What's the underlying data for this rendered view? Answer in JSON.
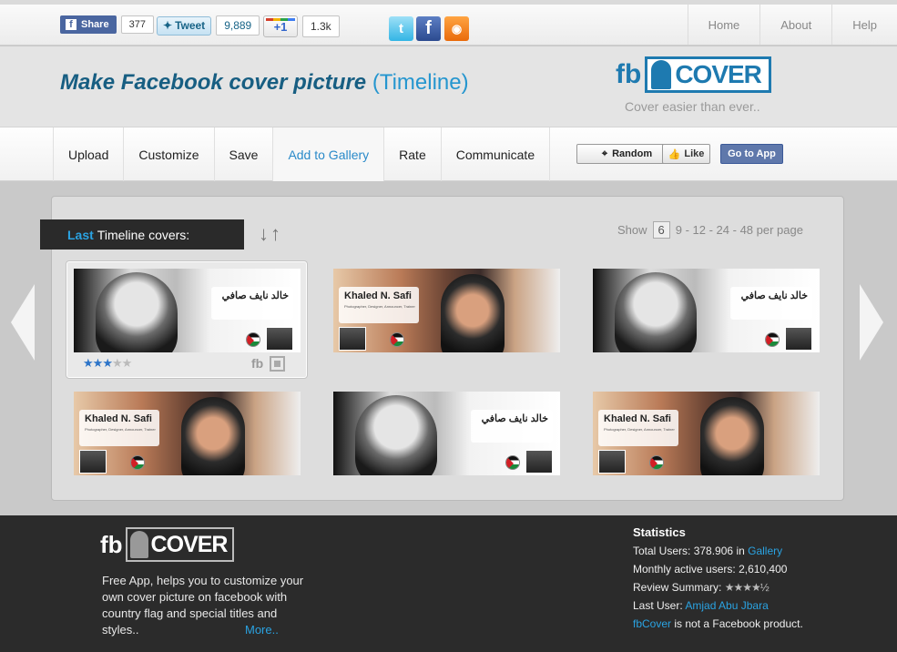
{
  "topbar": {
    "fb_share_label": "Share",
    "fb_share_count": "377",
    "tweet_label": "Tweet",
    "tweet_count": "9,889",
    "gplus_label": "+1",
    "gplus_count": "1.3k",
    "nav": [
      "Home",
      "About",
      "Help"
    ]
  },
  "header": {
    "title": "Make Facebook cover picture",
    "title_highlight": "(Timeline)",
    "logo_fb": "fb",
    "logo_text": "COVER",
    "tagline": "Cover easier than ever.."
  },
  "navbar": {
    "items": [
      "Upload",
      "Customize",
      "Save",
      "Add to Gallery",
      "Rate",
      "Communicate"
    ],
    "active": "Add to Gallery",
    "random_label": "Random",
    "like_label": "Like",
    "go_app_label": "Go to App"
  },
  "gallery": {
    "heading_bold": "Last",
    "heading_rest": "Timeline covers:",
    "show_label": "Show",
    "show_selected": "6",
    "show_options": "9 - 12 - 24 - 48 per page",
    "covers": [
      {
        "style": "bw",
        "name": "خالد نايف صافي"
      },
      {
        "style": "col",
        "name": "Khaled N. Safi",
        "sub": "Photographer, Designer, Announcer, Trainer"
      },
      {
        "style": "bw",
        "name": "خالد نايف صافي"
      },
      {
        "style": "col",
        "name": "Khaled N. Safi",
        "sub": "Photographer, Designer, Announcer, Trainer"
      },
      {
        "style": "bw",
        "name": "خالد نايف صافي"
      },
      {
        "style": "col",
        "name": "Khaled N. Safi",
        "sub": "Photographer, Designer, Announcer, Trainer"
      }
    ],
    "highlight_rating": 3,
    "highlight_rating_max": 5,
    "card_fb_icon": "fb"
  },
  "footer": {
    "logo_fb": "fb",
    "logo_text": "COVER",
    "description": "Free App, helps you to customize your own cover picture on facebook with country flag and special titles and styles..",
    "more_label": "More..",
    "stats": {
      "heading": "Statistics",
      "total_users_label": "Total Users:",
      "total_users_value": "378.906",
      "total_users_in": "in",
      "gallery_link": "Gallery",
      "monthly_label": "Monthly active users:",
      "monthly_value": "2,610,400",
      "review_label": "Review Summary:",
      "review_stars": "★★★★½",
      "last_user_label": "Last User:",
      "last_user": "Amjad Abu Jbara",
      "disclaimer_link": "fbCover",
      "disclaimer_rest": "is not a Facebook product."
    }
  },
  "colors": {
    "accent_blue": "#2596cf",
    "title_blue": "#175e82",
    "logo_blue": "#1e7ab0",
    "footer_bg": "#2b2b2b",
    "star_on": "#2c74c8"
  }
}
